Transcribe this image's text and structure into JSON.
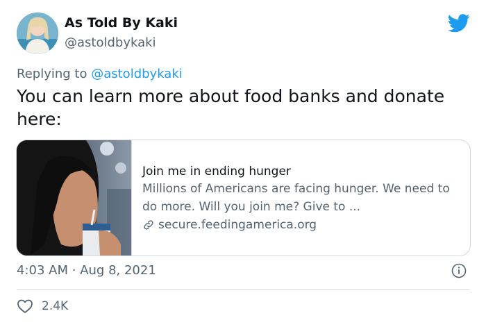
{
  "author": {
    "name": "As Told By Kaki",
    "handle": "@astoldbykaki",
    "avatar_icon": "profile-photo"
  },
  "reply": {
    "prefix": "Replying to",
    "mention": "@astoldbykaki"
  },
  "tweet": {
    "text": "You can learn more about food banks and donate here:"
  },
  "card": {
    "title": "Join me in ending hunger",
    "description": "Millions of Americans are facing hunger. We need to do more. Will you join me? Give to ...",
    "domain": "secure.feedingamerica.org"
  },
  "meta": {
    "time": "4:03 AM",
    "separator": "·",
    "date": "Aug 8, 2021"
  },
  "engagement": {
    "likes": "2.4K"
  },
  "colors": {
    "accent": "#1d9bf0",
    "muted": "#536471",
    "border": "#cfd9de"
  }
}
